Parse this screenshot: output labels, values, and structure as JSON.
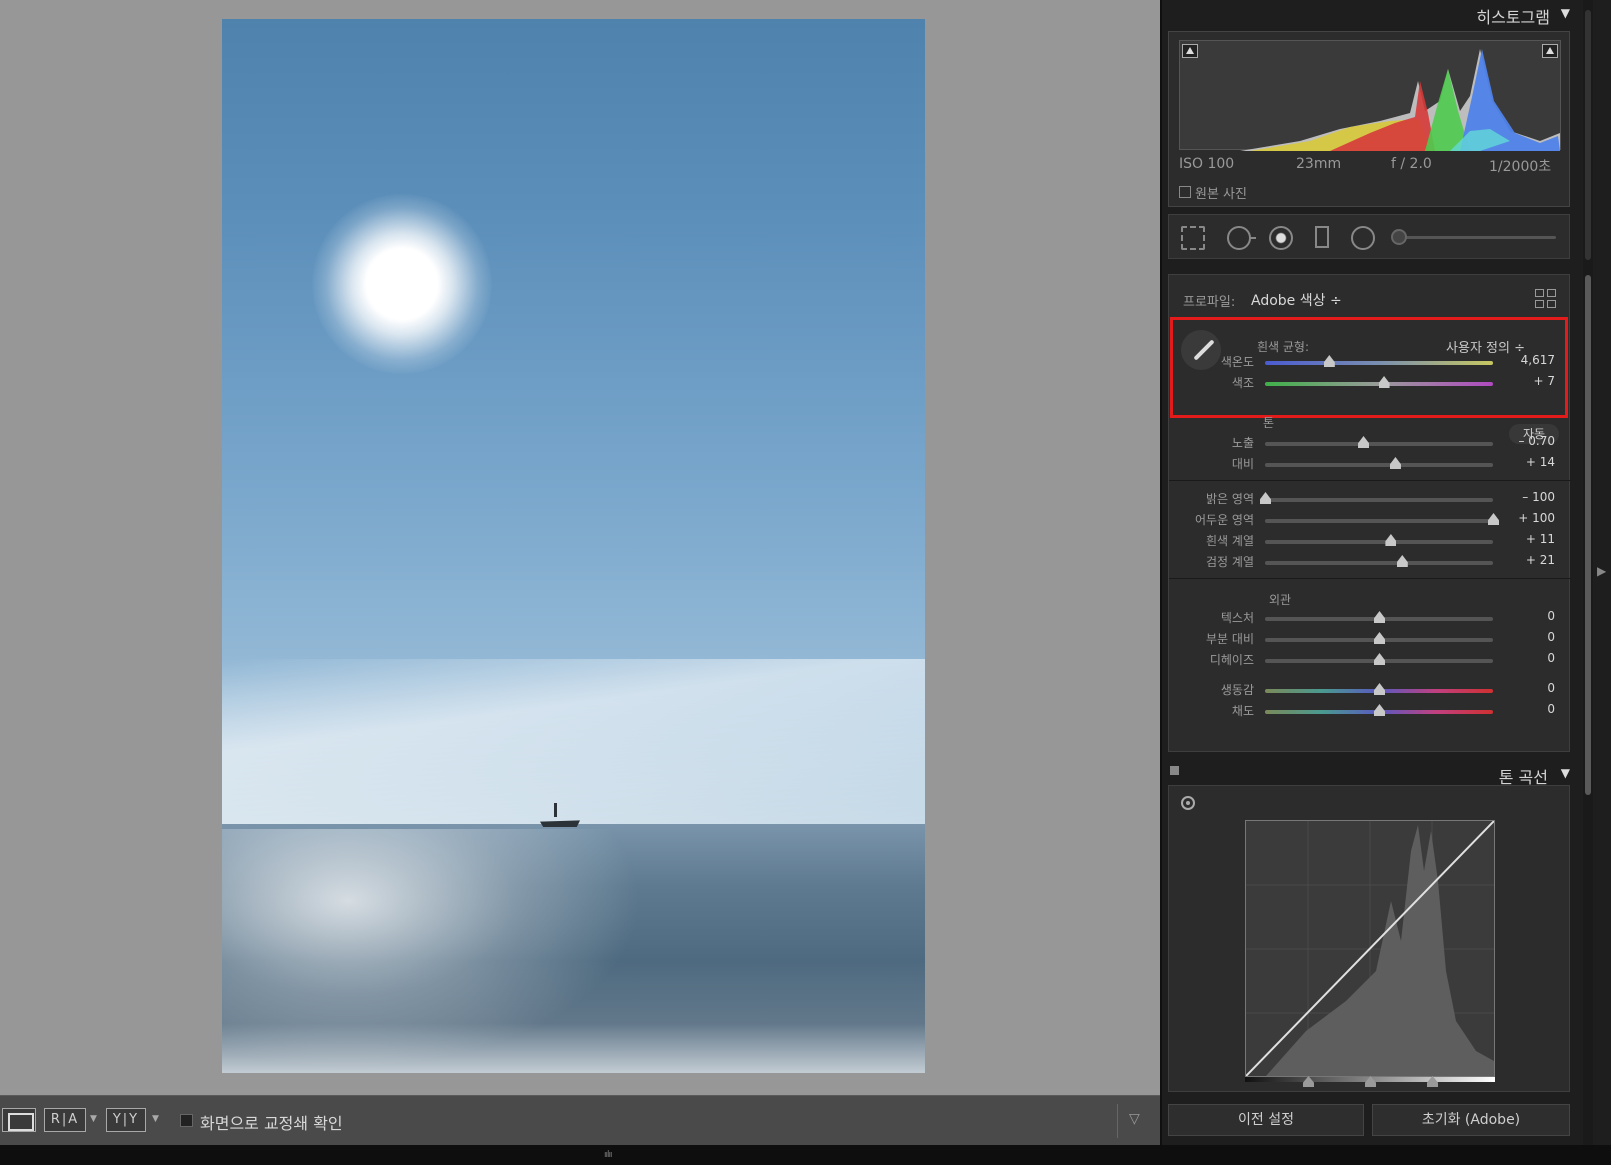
{
  "toolbar": {
    "loupe_label": "",
    "ra_label": "R|A",
    "yy_label": "Y|Y",
    "proof_label": "화면으로 교정쇄 확인"
  },
  "histogram": {
    "title": "히스토그램",
    "iso": "ISO 100",
    "focal": "23mm",
    "aperture": "f / 2.0",
    "shutter": "1/2000초",
    "original_label": "원본 사진"
  },
  "basic": {
    "profile_label": "프로파일:",
    "profile_value": "Adobe 색상 ÷",
    "wb_label": "흰색 균형:",
    "wb_value": "사용자 정의 ÷",
    "tone_label": "톤",
    "auto_label": "자동",
    "presence_label": "외관",
    "sliders": [
      {
        "label": "색온도",
        "value": "4,617",
        "pos": 0.28,
        "style": "temp"
      },
      {
        "label": "색조",
        "value": "+ 7",
        "pos": 0.52,
        "style": "tint"
      },
      {
        "label": "노출",
        "value": "– 0.70",
        "pos": 0.43,
        "style": "plain"
      },
      {
        "label": "대비",
        "value": "+ 14",
        "pos": 0.57,
        "style": "plain"
      },
      {
        "label": "밝은 영역",
        "value": "– 100",
        "pos": 0.0,
        "style": "plain"
      },
      {
        "label": "어두운 영역",
        "value": "+ 100",
        "pos": 1.0,
        "style": "plain"
      },
      {
        "label": "흰색 계열",
        "value": "+ 11",
        "pos": 0.55,
        "style": "plain"
      },
      {
        "label": "검정 계열",
        "value": "+ 21",
        "pos": 0.6,
        "style": "plain"
      },
      {
        "label": "텍스처",
        "value": "0",
        "pos": 0.5,
        "style": "plain"
      },
      {
        "label": "부분 대비",
        "value": "0",
        "pos": 0.5,
        "style": "plain"
      },
      {
        "label": "디헤이즈",
        "value": "0",
        "pos": 0.5,
        "style": "plain"
      },
      {
        "label": "생동감",
        "value": "0",
        "pos": 0.5,
        "style": "sat"
      },
      {
        "label": "채도",
        "value": "0",
        "pos": 0.5,
        "style": "sat"
      }
    ]
  },
  "tone_curve": {
    "title": "톤 곡선"
  },
  "buttons": {
    "previous": "이전 설정",
    "reset": "초기화 (Adobe)"
  },
  "colors": {
    "highlight_box": "#e41b1b"
  }
}
